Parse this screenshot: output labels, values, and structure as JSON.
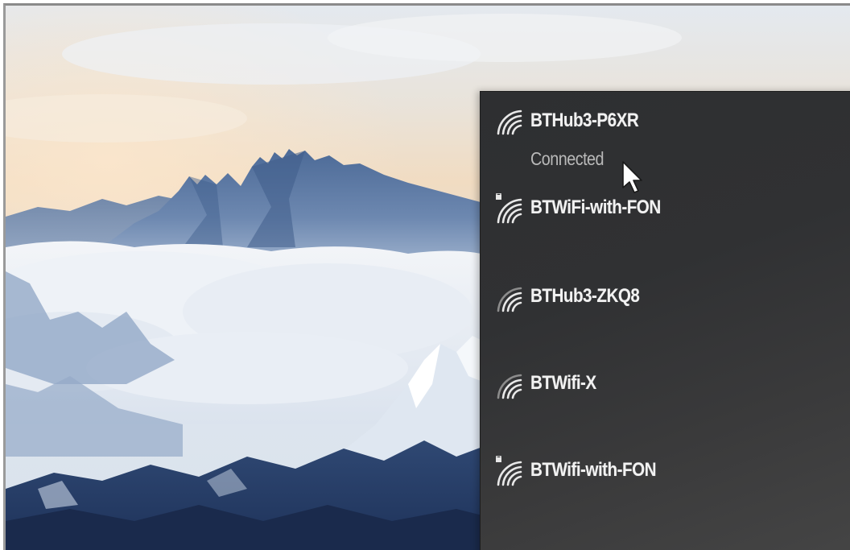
{
  "desktop": {
    "wallpaper": "snowy mountain peaks above clouds"
  },
  "wifi_flyout": {
    "networks": [
      {
        "name": "BTHub3-P6XR",
        "status": "Connected",
        "icon": "wifi-signal-icon"
      },
      {
        "name": "BTWiFi-with-FON",
        "status": "",
        "icon": "wifi-secured-signal-icon"
      },
      {
        "name": "BTHub3-ZKQ8",
        "status": "",
        "icon": "wifi-signal-icon"
      },
      {
        "name": "BTWifi-X",
        "status": "",
        "icon": "wifi-signal-icon"
      },
      {
        "name": "BTWifi-with-FON",
        "status": "",
        "icon": "wifi-secured-signal-icon"
      }
    ]
  },
  "colors": {
    "flyout_background": "#303133",
    "network_text": "#f2f2f2",
    "status_text": "#b9b9b9",
    "sky_top": "#dfe6ee",
    "horizon_warm": "#f1dcc2",
    "mountain_blue": "#3e5a86"
  }
}
